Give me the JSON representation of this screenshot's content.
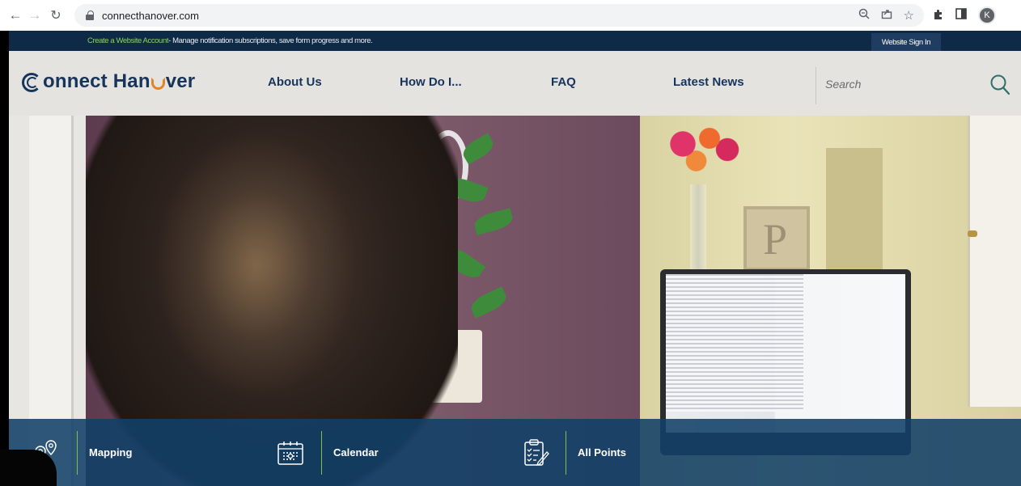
{
  "browser": {
    "url": "connecthanover.com",
    "profile_initial": "K",
    "icons": [
      "back-arrow-icon",
      "forward-arrow-icon",
      "reload-icon",
      "lock-icon",
      "zoom-icon",
      "share-icon",
      "bookmark-star-icon",
      "extensions-puzzle-icon",
      "side-panel-icon",
      "profile-avatar"
    ]
  },
  "topbar": {
    "create_account_link": "Create a Website Account",
    "description": " - Manage notification subscriptions, save form progress and more.",
    "sign_in": "Website Sign In"
  },
  "header": {
    "logo_text_part1": "onnect Han",
    "logo_text_part2": "ver",
    "nav": [
      {
        "label": "About Us"
      },
      {
        "label": "How Do I..."
      },
      {
        "label": "FAQ"
      },
      {
        "label": "Latest News"
      }
    ],
    "search_placeholder": "Search"
  },
  "hero": {
    "image": "woman-at-laptop-photo"
  },
  "quick_links": [
    {
      "label": "Mapping",
      "icon": "map-pin-icon"
    },
    {
      "label": "Calendar",
      "icon": "calendar-icon"
    },
    {
      "label": "All Points",
      "icon": "clipboard-checklist-icon"
    }
  ],
  "colors": {
    "navy": "#0e2a47",
    "brand_blue": "#17345a",
    "accent_green": "#8ccf6b",
    "accent_orange": "#e0842a",
    "quickbar_blue": "#114068"
  }
}
